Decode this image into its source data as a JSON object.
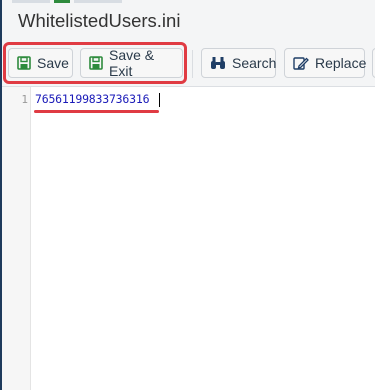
{
  "window": {
    "title": "WhitelistedUsers.ini"
  },
  "toolbar": {
    "save_label": "Save",
    "save_exit_label": "Save & Exit",
    "search_label": "Search",
    "replace_label": "Replace"
  },
  "icons": {
    "save": "floppy-disk-icon",
    "save_exit": "floppy-disk-icon",
    "search": "binoculars-icon",
    "replace": "edit-icon"
  },
  "colors": {
    "highlight": "#e03b43",
    "save_icon": "#2e8b3d",
    "search_icon": "#1f3e66",
    "code_text": "#1a1ab8"
  },
  "editor": {
    "lines": [
      {
        "number": "1",
        "text": "76561199833736316"
      }
    ]
  }
}
